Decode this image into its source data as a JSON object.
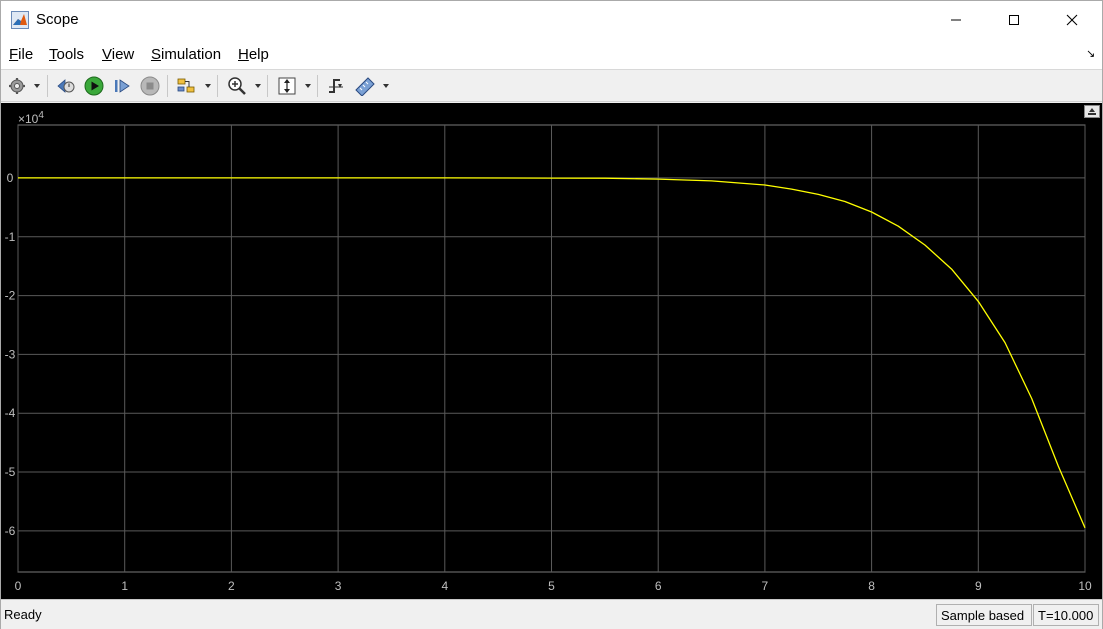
{
  "window": {
    "title": "Scope",
    "icon": "matlab-logo-icon"
  },
  "menu": {
    "items": [
      "File",
      "Tools",
      "View",
      "Simulation",
      "Help"
    ]
  },
  "toolbar": {
    "buttons": [
      "configuration-properties",
      "step-back",
      "run",
      "step-forward",
      "stop",
      "highlight-simulink-block",
      "zoom-in",
      "scale-axes",
      "triggers",
      "measurements"
    ]
  },
  "plot": {
    "exponent_label_base": "×10",
    "exponent_label_power": "4"
  },
  "chart_data": {
    "type": "line",
    "title": "",
    "xlabel": "",
    "ylabel": "",
    "xlim": [
      0,
      10
    ],
    "ylim": [
      -6.7,
      0.9
    ],
    "y_scale_factor": "×10^4",
    "x_ticks": [
      "0",
      "1",
      "2",
      "3",
      "4",
      "5",
      "6",
      "7",
      "8",
      "9",
      "10"
    ],
    "y_ticks": [
      "0",
      "-1",
      "-2",
      "-3",
      "-4",
      "-5",
      "-6"
    ],
    "y_tick_values": [
      0,
      -1,
      -2,
      -3,
      -4,
      -5,
      -6
    ],
    "grid": true,
    "background": "#000000",
    "series": [
      {
        "color": "#ffff00",
        "x": [
          0,
          1,
          2,
          3,
          4,
          5,
          5.5,
          6,
          6.5,
          7,
          7.25,
          7.5,
          7.75,
          8,
          8.25,
          8.5,
          8.75,
          9,
          9.25,
          9.5,
          9.75,
          10
        ],
        "y": [
          0,
          0,
          0,
          0,
          0,
          -0.002,
          -0.005,
          -0.02,
          -0.05,
          -0.12,
          -0.19,
          -0.28,
          -0.4,
          -0.58,
          -0.82,
          -1.14,
          -1.55,
          -2.1,
          -2.8,
          -3.75,
          -4.9,
          -5.95
        ]
      }
    ]
  },
  "status": {
    "ready": "Ready",
    "mode": "Sample based",
    "time": "T=10.000"
  }
}
